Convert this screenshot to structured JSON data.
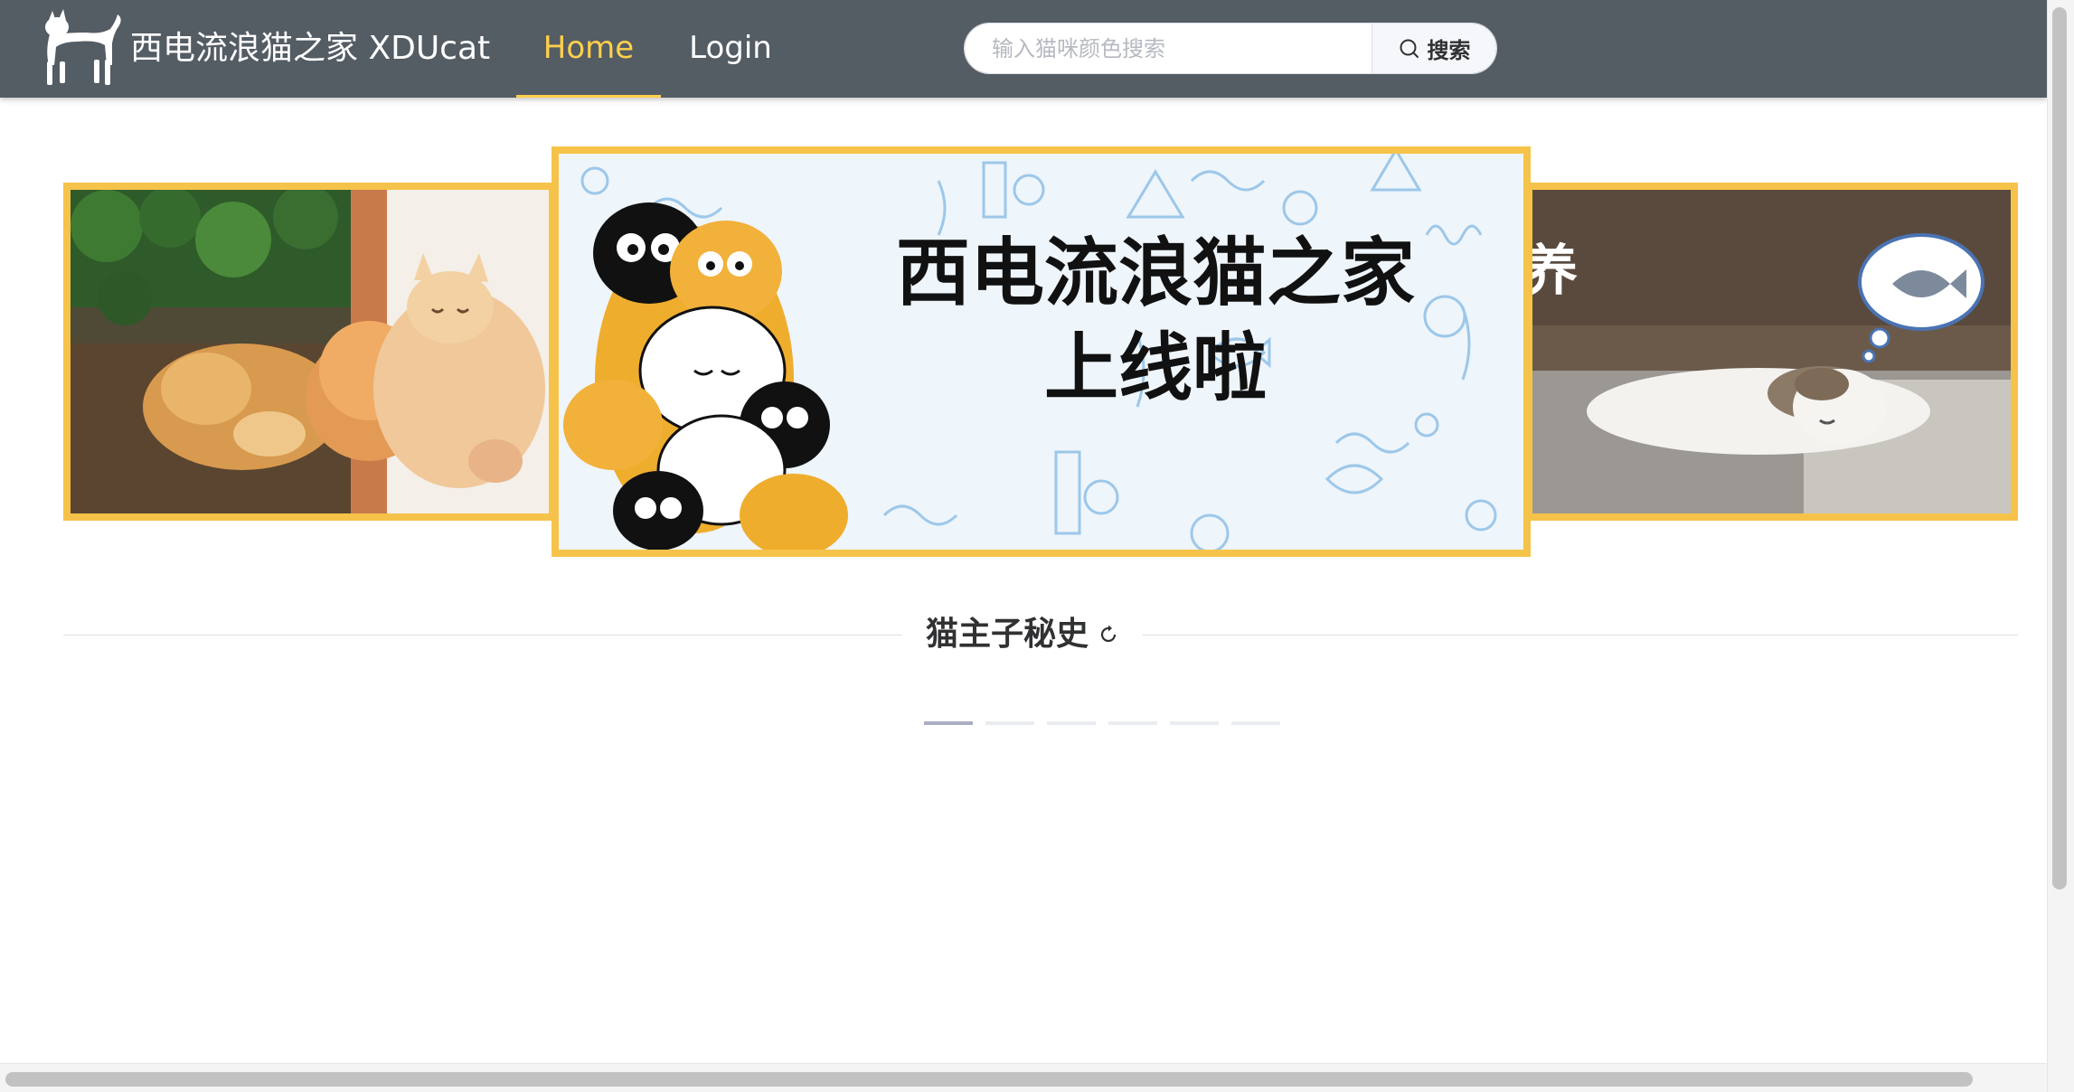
{
  "nav": {
    "title": "西电流浪猫之家 XDUcat",
    "items": [
      {
        "label": "Home",
        "active": true
      },
      {
        "label": "Login",
        "active": false
      }
    ],
    "accent_color": "#ffd04b",
    "bar_color": "#545c64"
  },
  "search": {
    "placeholder": "输入猫咪颜色搜索",
    "value": "",
    "button_label": "搜索",
    "button_icon": "search-icon"
  },
  "carousel": {
    "center_banner": {
      "line1": "西电流浪猫之家",
      "line2": "上线啦"
    },
    "right_banner_text": "养",
    "slide_count": 6,
    "active_index": 0,
    "frame_color": "#f6c34a"
  },
  "section": {
    "title": "猫主子秘史",
    "icon": "refresh-icon"
  }
}
